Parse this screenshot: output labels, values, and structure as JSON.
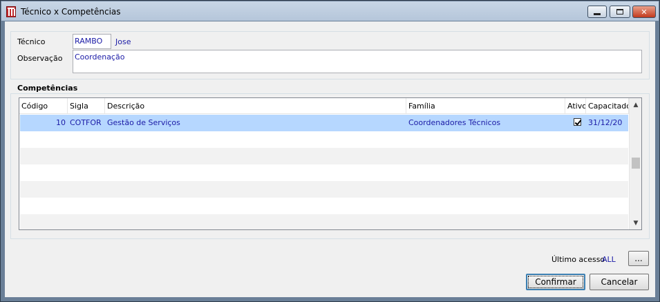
{
  "window": {
    "title": "Técnico x Competências",
    "controls": {
      "minimize": "minimize-icon",
      "maximize": "maximize-icon",
      "close": "✕"
    }
  },
  "header_form": {
    "tecnico_label": "Técnico",
    "tecnico_code": "RAMBO",
    "tecnico_name": "Jose",
    "observacao_label": "Observação",
    "observacao_value": "Coordenação"
  },
  "competencias": {
    "section_title": "Competências",
    "columns": [
      "Código",
      "Sigla",
      "Descrição",
      "Família",
      "Ativo",
      "Capacitado"
    ],
    "rows": [
      {
        "codigo": "10",
        "sigla": "COTFOR",
        "descricao": "Gestão de Serviços",
        "familia": "Coordenadores Técnicos",
        "ativo": true,
        "capacitado": "31/12/20"
      }
    ]
  },
  "footer": {
    "ultimo_acesso_label": "Último acesso",
    "ultimo_acesso_value": "ALL",
    "ellipsis_button": "...",
    "confirm_label": "Confirmar",
    "cancel_label": "Cancelar"
  },
  "colors": {
    "selection": "#b6d7ff",
    "value_text": "#1a1aa6",
    "default_button_border": "#3c7fb1"
  }
}
